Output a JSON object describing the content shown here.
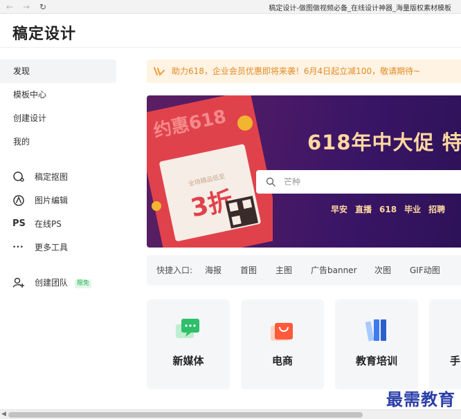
{
  "browser": {
    "back_glyph": "←",
    "forward_glyph": "→",
    "refresh_glyph": "↻",
    "title": "稿定设计-做图做视频必备_在线设计神器_海量版权素材模板"
  },
  "app": {
    "logo": "稿定设计"
  },
  "sidebar": {
    "nav": [
      {
        "label": "发现",
        "active": true
      },
      {
        "label": "模板中心"
      },
      {
        "label": "创建设计"
      },
      {
        "label": "我的"
      }
    ],
    "tools": [
      {
        "label": "稿定抠图",
        "icon": "cutout-icon"
      },
      {
        "label": "图片编辑",
        "icon": "image-edit-icon"
      },
      {
        "label": "在线PS",
        "icon": "ps-icon",
        "icon_text": "PS"
      },
      {
        "label": "更多工具",
        "icon": "more-dots-icon",
        "icon_text": "•••"
      }
    ],
    "team": {
      "label": "创建团队",
      "icon": "add-team-icon",
      "badge": "限免"
    }
  },
  "notice": {
    "text": "助力618，企业会员优惠即将来袭！6月4日起立减100，敬请期待~"
  },
  "hero": {
    "title": "618年中大促 特",
    "search_placeholder": "芒种",
    "hot_tags": [
      "早安",
      "直播",
      "618",
      "毕业",
      "招聘"
    ]
  },
  "quick_entry": {
    "label": "快捷入口:",
    "links": [
      "海报",
      "首图",
      "主图",
      "广告banner",
      "次图",
      "GIF动图"
    ]
  },
  "cards": [
    {
      "label": "新媒体",
      "icon": "chat-bubble-icon"
    },
    {
      "label": "电商",
      "icon": "shopping-bag-icon"
    },
    {
      "label": "教育培训",
      "icon": "books-icon"
    },
    {
      "label": "手",
      "icon": ""
    }
  ],
  "scrollbar": {
    "left_glyph": "◀"
  },
  "watermark": "最需教育",
  "colors": {
    "accent_orange": "#e38a23",
    "hero_title": "#ffd9a0",
    "free_badge": "#20b050",
    "watermark": "#2a3fa8"
  }
}
